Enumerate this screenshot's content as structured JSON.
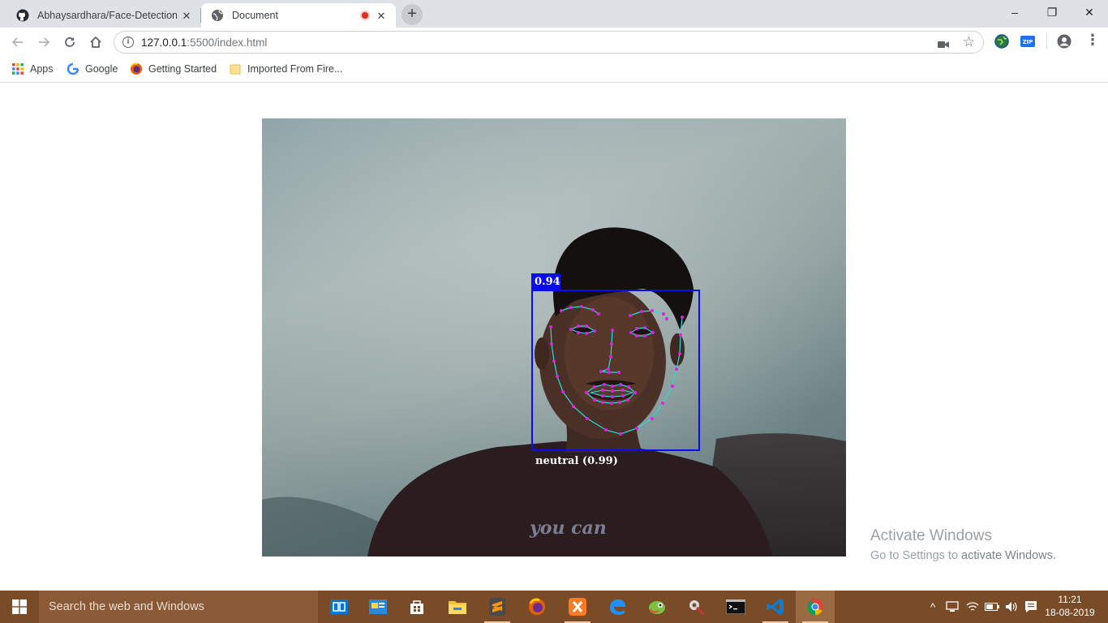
{
  "browser": {
    "tabs": [
      {
        "title": "Abhaysardhara/Face-Detection",
        "icon": "github-icon",
        "active": false
      },
      {
        "title": "Document",
        "icon": "globe-icon",
        "active": true,
        "recording": true
      }
    ],
    "window_controls": {
      "minimize": "–",
      "restore": "❐",
      "close": "✕"
    },
    "url": {
      "host": "127.0.0.1",
      "path": ":5500/index.html"
    },
    "bookmarks": [
      {
        "label": "Apps",
        "icon": "apps-grid-icon"
      },
      {
        "label": "Google",
        "icon": "google-icon"
      },
      {
        "label": "Getting Started",
        "icon": "firefox-icon"
      },
      {
        "label": "Imported From Fire...",
        "icon": "folder-icon"
      }
    ],
    "extensions": [
      {
        "name": "globe-extension-icon"
      },
      {
        "name": "zip-extension-icon",
        "label": "ZIP"
      }
    ]
  },
  "detection": {
    "score": "0.94",
    "expression": "neutral (0.99)",
    "box_color": "#0a0af5",
    "landmark_color": "#e020e0",
    "contour_color": "#22dddd"
  },
  "webcam": {
    "shirt_text": "you can"
  },
  "watermark": {
    "line1": "Activate Windows",
    "line2_prefix": "Go to Settings to ",
    "line2_emph": "activate Windows."
  },
  "taskbar": {
    "search_placeholder": "Search the web and Windows",
    "apps": [
      "task-view-icon",
      "file-manager-icon",
      "store-icon",
      "file-explorer-icon",
      "sublime-text-icon",
      "firefox-icon",
      "xampp-icon",
      "edge-icon",
      "chameleon-app-icon",
      "tools-icon",
      "terminal-icon",
      "vscode-icon",
      "chrome-icon"
    ],
    "time": "11:21",
    "date": "18-08-2019"
  }
}
